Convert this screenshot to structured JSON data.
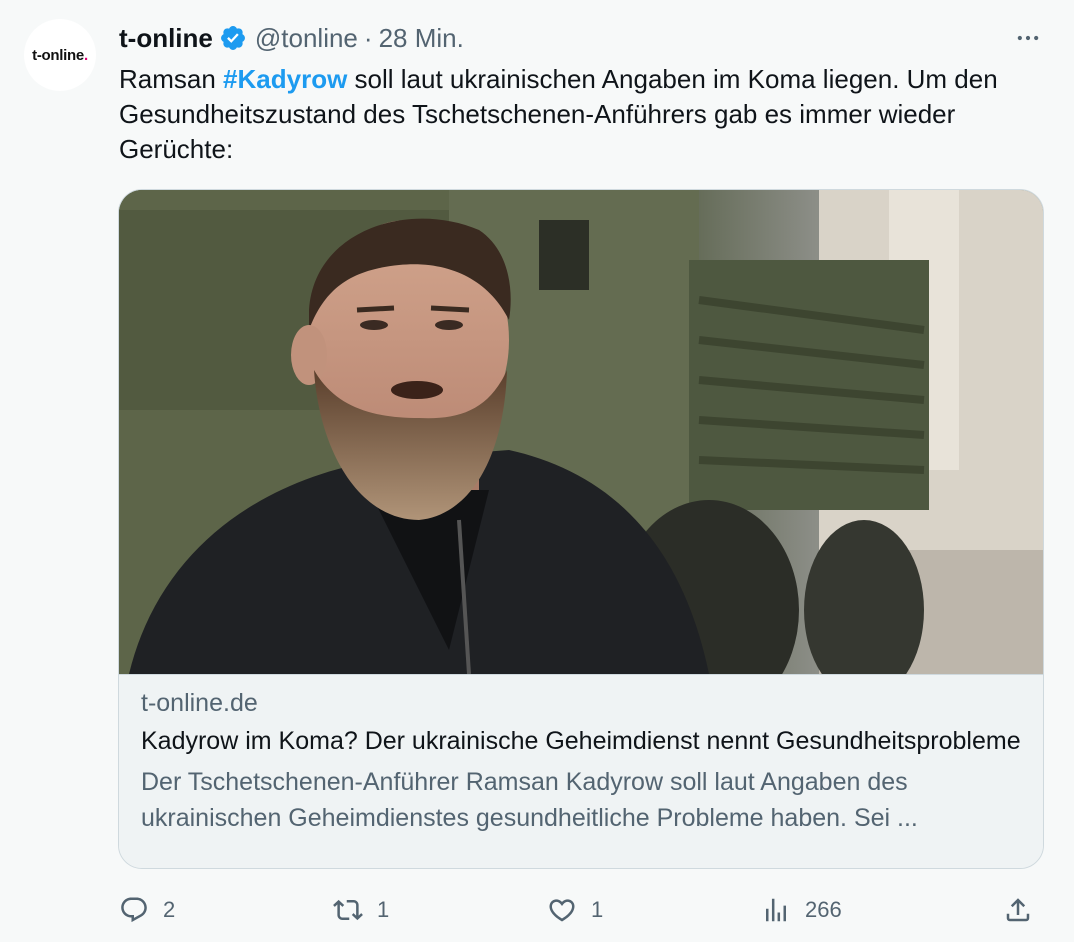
{
  "tweet": {
    "avatar_text": "t-online",
    "avatar_dot": ".",
    "display_name": "t-online",
    "handle": "@tonline",
    "separator": "·",
    "time": "28 Min.",
    "text_before": "Ramsan ",
    "hashtag": "#Kadyrow",
    "text_after": " soll laut ukrainischen Angaben im Koma liegen. Um den Gesundheitszustand des Tschetschenen-Anführers gab es immer wieder Gerüchte:"
  },
  "card": {
    "domain": "t-online.de",
    "title": "Kadyrow im Koma? Der ukrainische Geheimdienst nennt Gesundheitsprobleme",
    "description": "Der Tschetschenen-Anführer Ramsan Kadyrow soll laut Angaben des ukrainischen Geheimdienstes gesundheitliche Probleme haben. Sei ..."
  },
  "actions": {
    "replies": "2",
    "reposts": "1",
    "likes": "1",
    "views": "266"
  },
  "icons": {
    "verified": "verified-badge-icon",
    "more": "more-horizontal-icon",
    "reply": "reply-icon",
    "repost": "repost-icon",
    "like": "heart-icon",
    "views": "analytics-icon",
    "share": "share-icon"
  },
  "colors": {
    "accent": "#1d9bf0",
    "secondary_text": "#536471",
    "brand_dot": "#e20074"
  }
}
